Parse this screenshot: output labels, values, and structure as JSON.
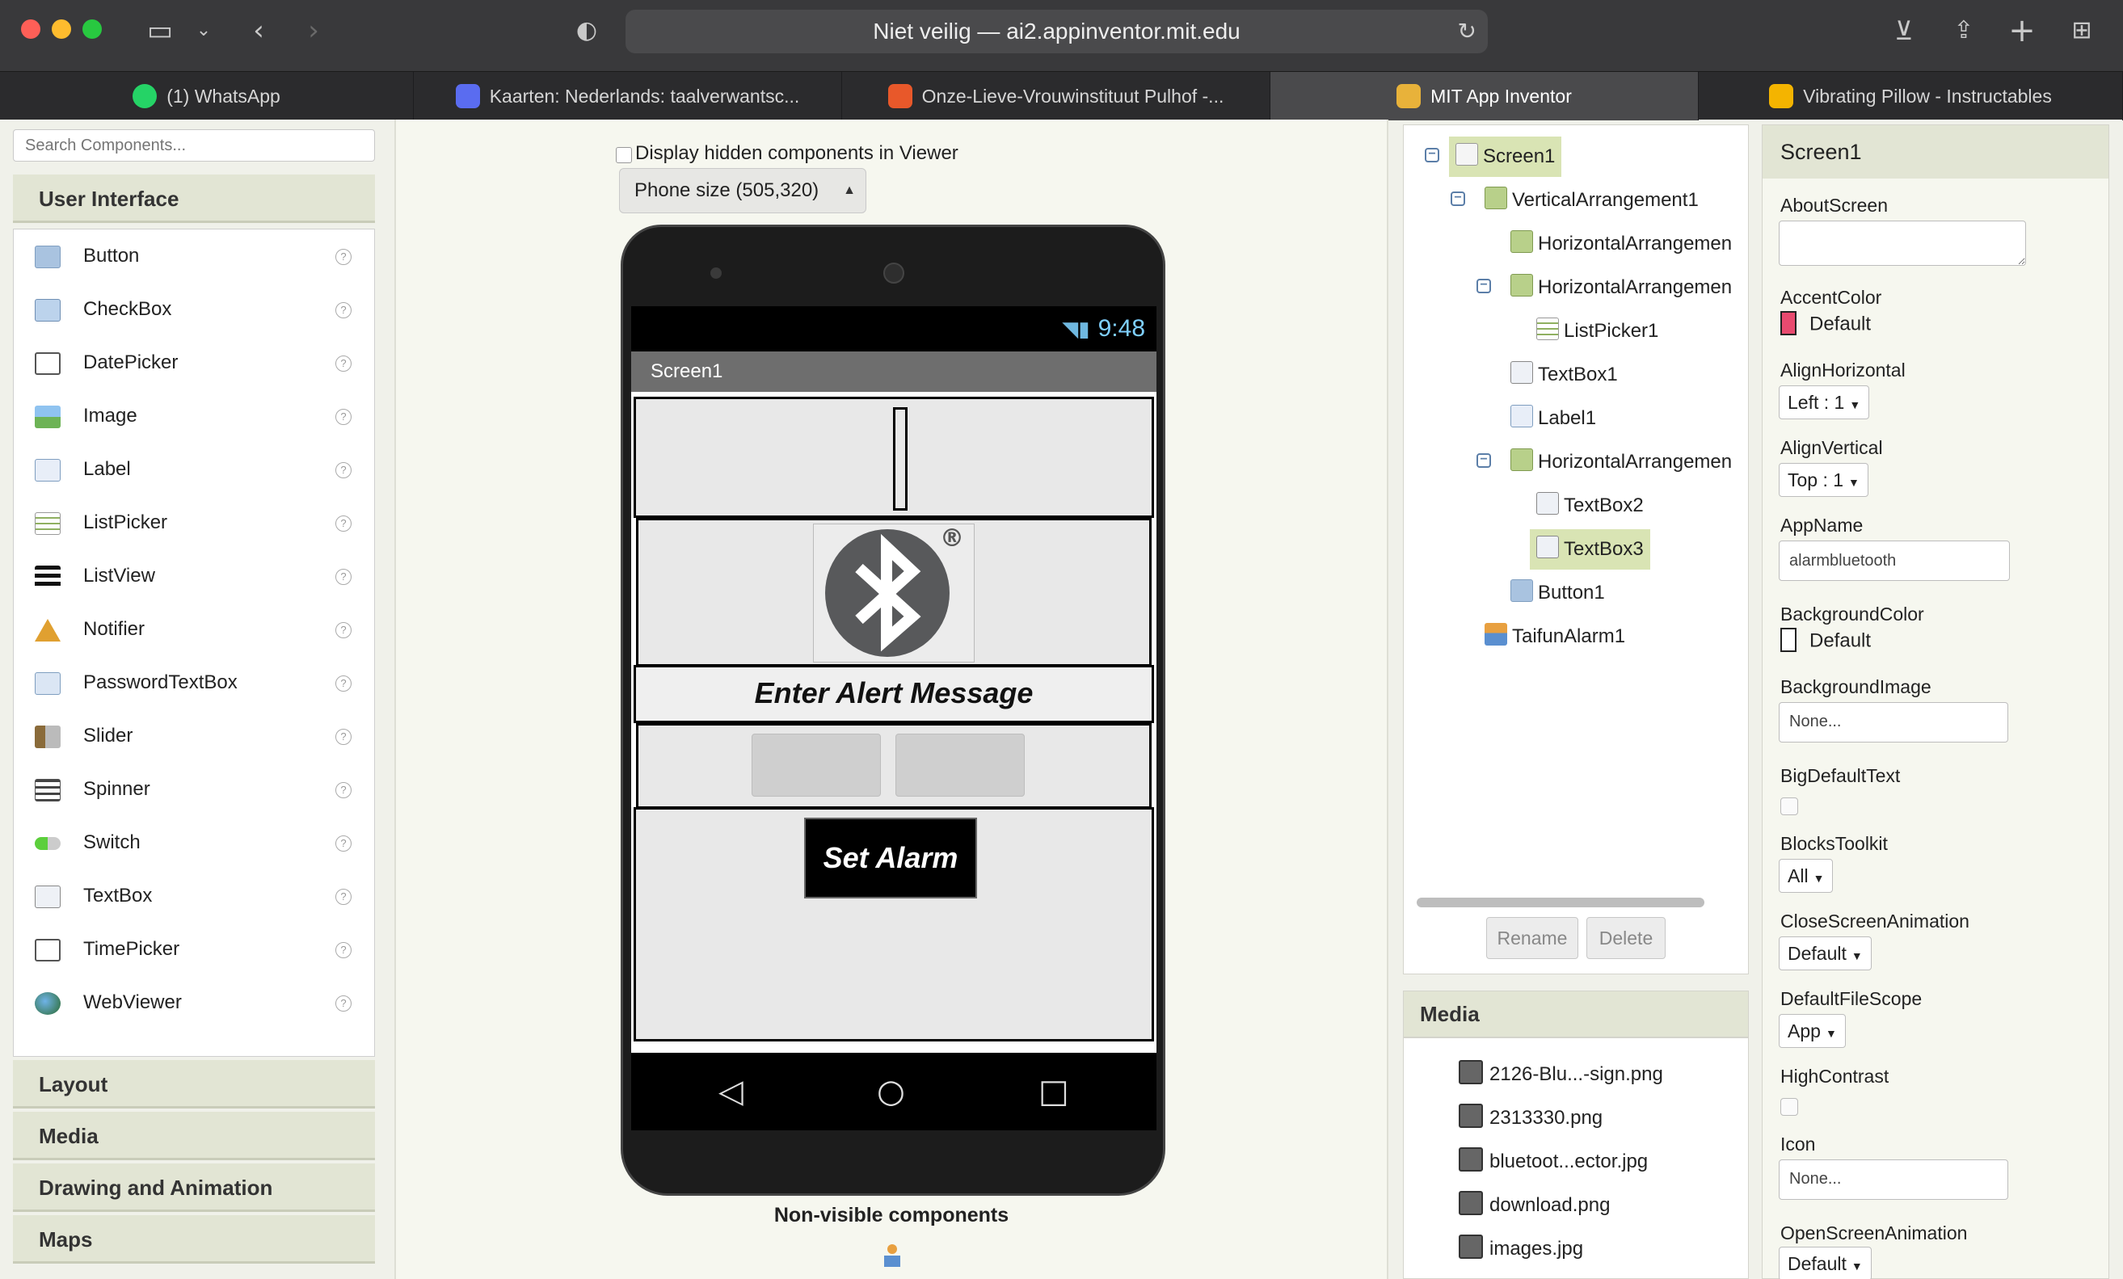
{
  "browser": {
    "url": "Niet veilig — ai2.appinventor.mit.edu",
    "tabs": [
      {
        "label": "(1) WhatsApp",
        "color": "#25d366"
      },
      {
        "label": "Kaarten: Nederlands: taalverwantsc...",
        "color": "#5a6cf0"
      },
      {
        "label": "Onze-Lieve-Vrouwinstituut Pulhof -...",
        "color": "#e8582a"
      },
      {
        "label": "MIT App Inventor",
        "color": "#e8b23a"
      },
      {
        "label": "Vibrating Pillow - Instructables",
        "color": "#f4b400"
      }
    ],
    "active_tab": "MIT App Inventor"
  },
  "palette": {
    "search_placeholder": "Search Components...",
    "category_open": "User Interface",
    "items": [
      {
        "label": "Button",
        "icon": "button-icon"
      },
      {
        "label": "CheckBox",
        "icon": "checkbox-icon"
      },
      {
        "label": "DatePicker",
        "icon": "calendar-icon"
      },
      {
        "label": "Image",
        "icon": "image-icon"
      },
      {
        "label": "Label",
        "icon": "label-icon"
      },
      {
        "label": "ListPicker",
        "icon": "listpicker-icon"
      },
      {
        "label": "ListView",
        "icon": "listview-icon"
      },
      {
        "label": "Notifier",
        "icon": "warning-icon"
      },
      {
        "label": "PasswordTextBox",
        "icon": "password-icon"
      },
      {
        "label": "Slider",
        "icon": "slider-icon"
      },
      {
        "label": "Spinner",
        "icon": "spinner-icon"
      },
      {
        "label": "Switch",
        "icon": "switch-icon"
      },
      {
        "label": "TextBox",
        "icon": "textbox-icon"
      },
      {
        "label": "TimePicker",
        "icon": "clock-icon"
      },
      {
        "label": "WebViewer",
        "icon": "globe-icon"
      }
    ],
    "categories": [
      "Layout",
      "Media",
      "Drawing and Animation",
      "Maps"
    ],
    "help_glyph": "?"
  },
  "viewer": {
    "display_hidden_label": "Display hidden components in Viewer",
    "phone_size": "Phone size (505,320)",
    "status_time": "9:48",
    "screen_title": "Screen1",
    "alert_label": "Enter Alert Message",
    "button_label": "Set Alarm",
    "registered_mark": "®",
    "nonvisible_label": "Non-visible components"
  },
  "components": {
    "tree": [
      {
        "label": "Screen1",
        "icon": "screen-icon",
        "selected": true
      },
      {
        "label": "VerticalArrangement1",
        "icon": "vertical-arrangement-icon"
      },
      {
        "label": "HorizontalArrangemen",
        "icon": "horizontal-arrangement-icon"
      },
      {
        "label": "HorizontalArrangemen",
        "icon": "horizontal-arrangement-icon"
      },
      {
        "label": "ListPicker1",
        "icon": "listpicker-icon"
      },
      {
        "label": "TextBox1",
        "icon": "textbox-icon"
      },
      {
        "label": "Label1",
        "icon": "label-icon"
      },
      {
        "label": "HorizontalArrangemen",
        "icon": "horizontal-arrangement-icon"
      },
      {
        "label": "TextBox2",
        "icon": "textbox-icon"
      },
      {
        "label": "TextBox3",
        "icon": "textbox-icon",
        "selected": true
      },
      {
        "label": "Button1",
        "icon": "button-icon"
      },
      {
        "label": "TaifunAlarm1",
        "icon": "extension-icon"
      }
    ],
    "rename_label": "Rename",
    "delete_label": "Delete"
  },
  "media": {
    "header": "Media",
    "files": [
      "2126-Blu...-sign.png",
      "2313330.png",
      "bluetoot...ector.jpg",
      "download.png",
      "images.jpg"
    ]
  },
  "properties": {
    "header": "Screen1",
    "about_screen_label": "AboutScreen",
    "accent_color_label": "AccentColor",
    "accent_color_value": "Default",
    "accent_color_hex": "#e84a6f",
    "align_horizontal_label": "AlignHorizontal",
    "align_horizontal_value": "Left : 1",
    "align_vertical_label": "AlignVertical",
    "align_vertical_value": "Top : 1",
    "app_name_label": "AppName",
    "app_name_value": "alarmbluetooth",
    "background_color_label": "BackgroundColor",
    "background_color_value": "Default",
    "background_image_label": "BackgroundImage",
    "background_image_value": "None...",
    "big_default_text_label": "BigDefaultText",
    "blocks_toolkit_label": "BlocksToolkit",
    "blocks_toolkit_value": "All",
    "close_screen_anim_label": "CloseScreenAnimation",
    "close_screen_anim_value": "Default",
    "default_file_scope_label": "DefaultFileScope",
    "default_file_scope_value": "App",
    "high_contrast_label": "HighContrast",
    "icon_label": "Icon",
    "icon_value": "None...",
    "open_screen_anim_label": "OpenScreenAnimation",
    "open_screen_anim_value": "Default"
  }
}
